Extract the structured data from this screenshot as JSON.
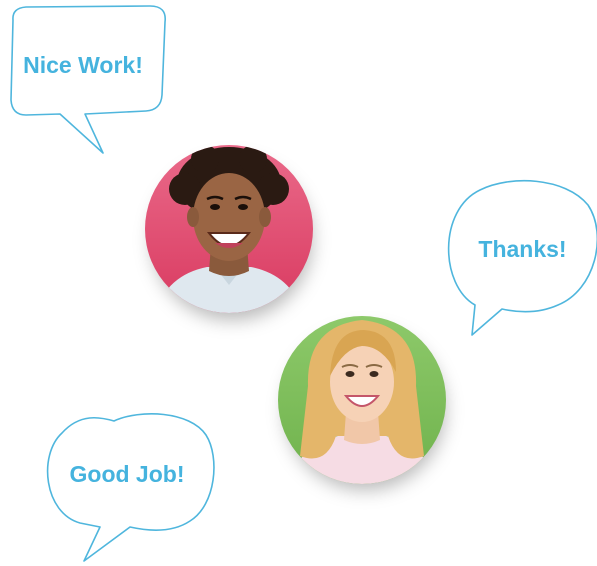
{
  "bubbles": {
    "nice_work": "Nice Work!",
    "thanks": "Thanks!",
    "good_job": "Good Job!"
  },
  "colors": {
    "bubble_stroke": "#4fb6dd",
    "bubble_text": "#45b3de",
    "man_bg": "#e0466b",
    "woman_bg": "#7dc15a"
  },
  "avatars": {
    "man": "smiling-man-portrait",
    "woman": "smiling-woman-portrait"
  }
}
